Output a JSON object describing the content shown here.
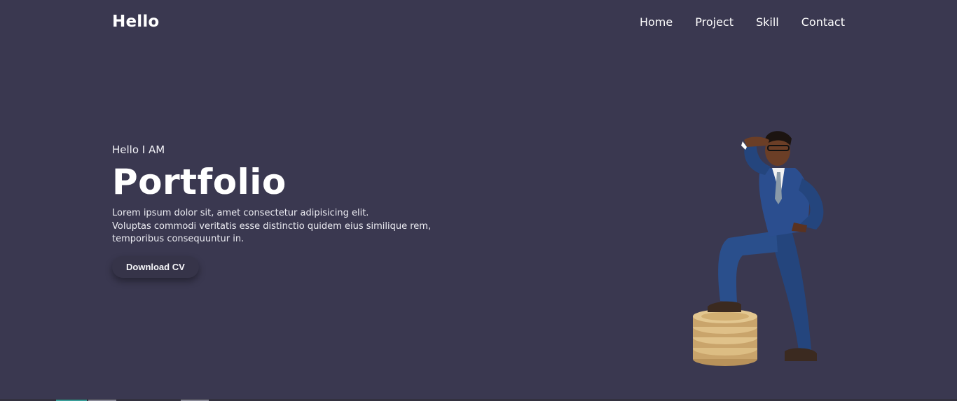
{
  "header": {
    "logo": "Hello",
    "nav": [
      "Home",
      "Project",
      "Skill",
      "Contact"
    ]
  },
  "hero": {
    "greeting": "Hello I AM",
    "title": "Portfolio",
    "description_lines": [
      "Lorem ipsum dolor sit, amet consectetur adipisicing elit.",
      "Voluptas commodi veritatis esse distinctio quidem eius similique rem,",
      "temporibus consequuntur in."
    ],
    "button_label": "Download CV"
  },
  "colors": {
    "background": "#3a3850",
    "button": "#363449",
    "suit": "#2a4a86",
    "coin": "#d9b777"
  },
  "illustration": "businessman-on-coins-icon"
}
